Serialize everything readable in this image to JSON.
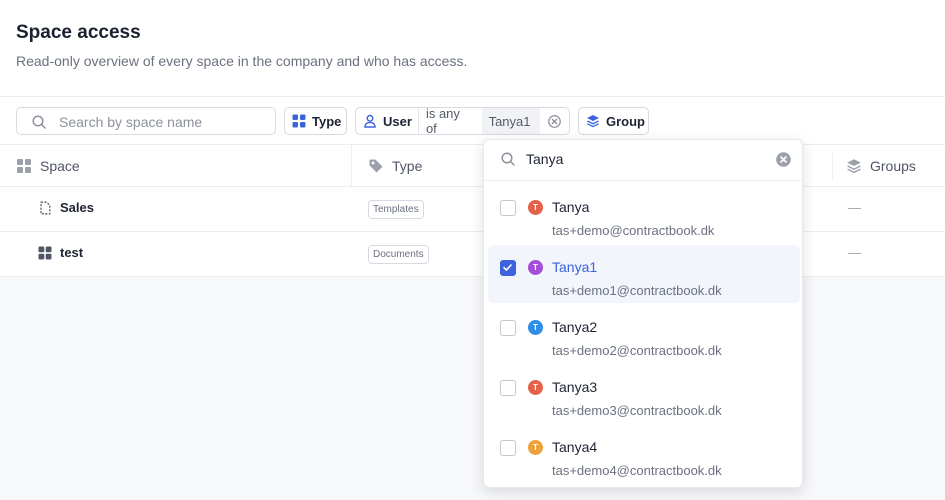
{
  "header": {
    "title": "Space access",
    "subtitle": "Read-only overview of every space in the company and who has access."
  },
  "filters": {
    "search_placeholder": "Search by space name",
    "type_label": "Type",
    "user_label": "User",
    "user_operator": "is any of",
    "user_value": "Tanya1",
    "group_label": "Group"
  },
  "table": {
    "columns": {
      "space": "Space",
      "type": "Type",
      "groups": "Groups"
    },
    "rows": [
      {
        "name": "Sales",
        "type": "Templates",
        "groups": "—",
        "icon": "template-icon"
      },
      {
        "name": "test",
        "type": "Documents",
        "groups": "—",
        "icon": "grid-icon"
      }
    ]
  },
  "dropdown": {
    "query": "Tanya",
    "options": [
      {
        "initial": "T",
        "name": "Tanya",
        "email": "tas+demo@contractbook.dk",
        "color": "#e4624a",
        "checked": false
      },
      {
        "initial": "T",
        "name": "Tanya1",
        "email": "tas+demo1@contractbook.dk",
        "color": "#a54fd9",
        "checked": true
      },
      {
        "initial": "T",
        "name": "Tanya2",
        "email": "tas+demo2@contractbook.dk",
        "color": "#2f8ee8",
        "checked": false
      },
      {
        "initial": "T",
        "name": "Tanya3",
        "email": "tas+demo3@contractbook.dk",
        "color": "#e4624a",
        "checked": false
      },
      {
        "initial": "T",
        "name": "Tanya4",
        "email": "tas+demo4@contractbook.dk",
        "color": "#eda13a",
        "checked": false
      }
    ]
  },
  "colors": {
    "accent": "#3c62dd",
    "icon_blue": "#3c62dd"
  }
}
